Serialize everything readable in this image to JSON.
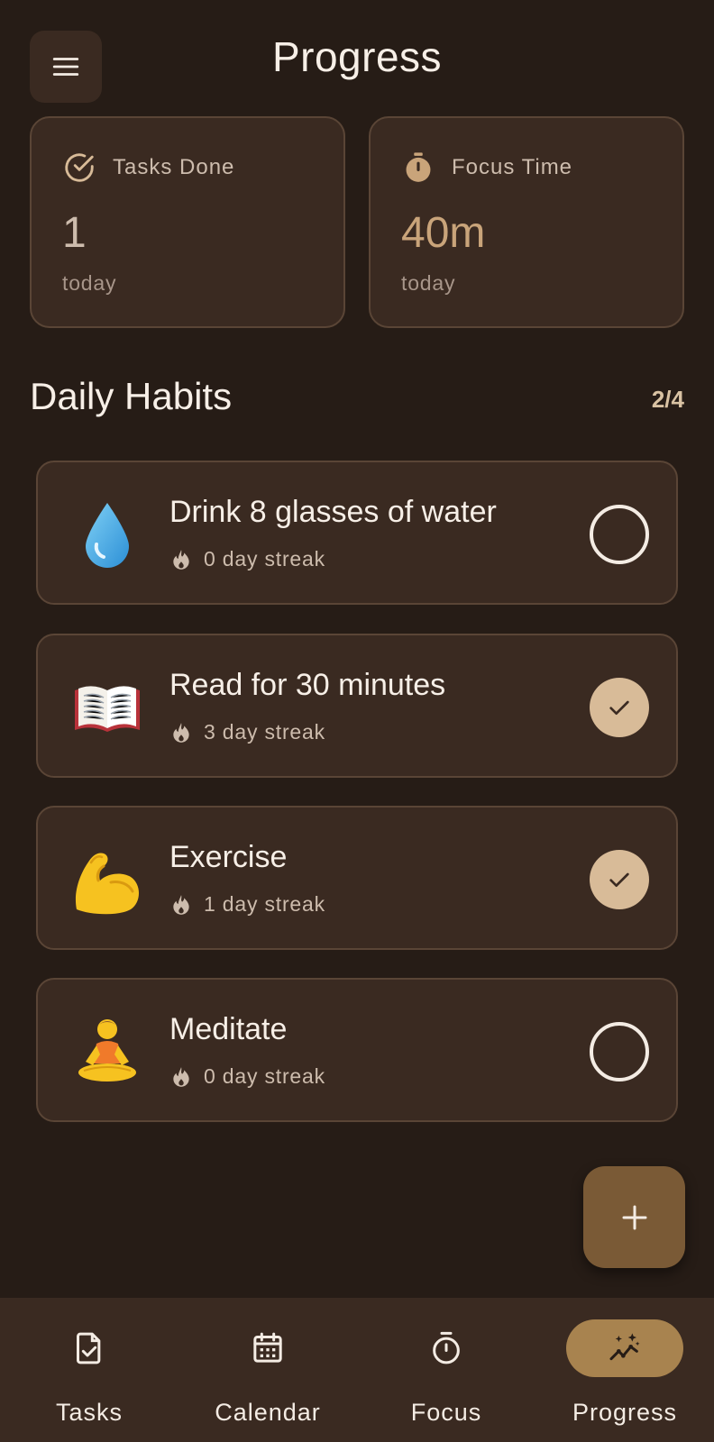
{
  "header": {
    "menu_icon": "hamburger-menu-icon",
    "title": "Progress"
  },
  "stats": [
    {
      "icon": "check-circle-icon",
      "label": "Tasks Done",
      "value": "1",
      "sub": "today"
    },
    {
      "icon": "stopwatch-icon",
      "label": "Focus Time",
      "value": "40m",
      "sub": "today"
    }
  ],
  "habits_section": {
    "title": "Daily Habits",
    "count": "2/4"
  },
  "habits": [
    {
      "emoji": "water-droplet",
      "name": "Drink 8 glasses of water",
      "streak": "0 day streak",
      "done": false
    },
    {
      "emoji": "open-book",
      "name": "Read for 30 minutes",
      "streak": "3 day streak",
      "done": true
    },
    {
      "emoji": "flexed-biceps",
      "name": "Exercise",
      "streak": "1 day streak",
      "done": true
    },
    {
      "emoji": "person-meditating",
      "name": "Meditate",
      "streak": "0 day streak",
      "done": false
    }
  ],
  "fab": {
    "icon": "plus-icon"
  },
  "nav": {
    "items": [
      {
        "label": "Tasks",
        "icon": "task-doc-icon",
        "active": false
      },
      {
        "label": "Calendar",
        "icon": "calendar-icon",
        "active": false
      },
      {
        "label": "Focus",
        "icon": "stopwatch-icon",
        "active": false
      },
      {
        "label": "Progress",
        "icon": "trending-sparkle-icon",
        "active": true
      }
    ]
  },
  "colors": {
    "background": "#261c16",
    "card": "#3a2a21",
    "card_border": "#5a4536",
    "accent": "#c9a47a",
    "check_fill": "#d8bb98",
    "fab": "#7a5a36",
    "nav_pill": "#a8834f"
  }
}
